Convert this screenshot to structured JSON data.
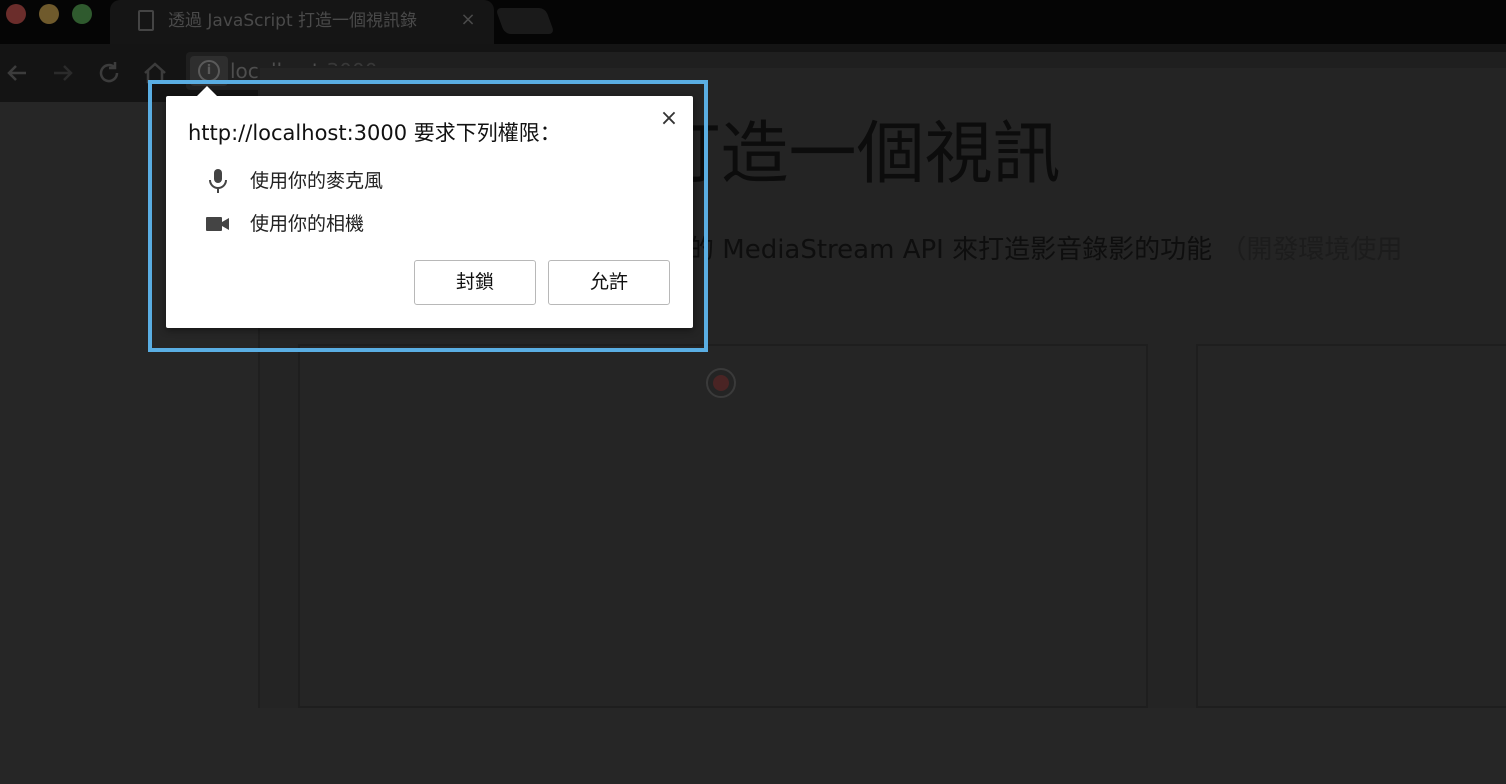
{
  "browser": {
    "tab": {
      "title": "透過 JavaScript 打造一個視訊錄",
      "close_glyph": "×",
      "icon": "page-icon"
    },
    "address_bar": {
      "host": "localhost",
      "port": ":3000",
      "icon": "info-icon"
    },
    "nav_icons": [
      "back-icon",
      "forward-icon",
      "reload-icon",
      "home-icon"
    ]
  },
  "page": {
    "title": "JavaScript 打造一個視訊",
    "description": "這個範例示範如何透過瀏覽器內建的 MediaStream API 來打造影音錄影的功能",
    "description_note": "（開發環境使用"
  },
  "permission_popup": {
    "title": "http://localhost:3000 要求下列權限：",
    "close_glyph": "×",
    "permissions": [
      {
        "icon": "microphone-icon",
        "label": "使用你的麥克風"
      },
      {
        "icon": "camera-icon",
        "label": "使用你的相機"
      }
    ],
    "block_label": "封鎖",
    "allow_label": "允許"
  },
  "colors": {
    "highlight": "#5aaee3",
    "popup_bg": "#ffffff",
    "overlay_bg": "#262626"
  }
}
